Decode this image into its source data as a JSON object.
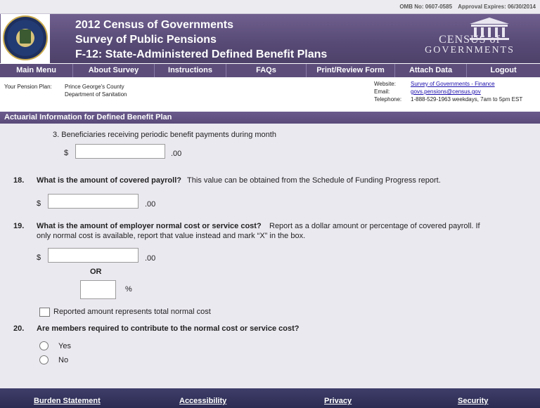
{
  "omb": {
    "number": "OMB No:  0607-0585",
    "approval": "Approval Expires:  06/30/2014"
  },
  "header": {
    "title_line1": "2012 Census of Governments",
    "title_line2": "Survey of Public Pensions",
    "title_line3": "F-12:  State-Administered Defined Benefit Plans",
    "logo_line1": "CENSUS of",
    "logo_line2": "GOVERNMENTS"
  },
  "nav": {
    "items": [
      {
        "label": "Main Menu"
      },
      {
        "label": "About Survey"
      },
      {
        "label": "Instructions"
      },
      {
        "label": "FAQs"
      },
      {
        "label": "Print/Review Form"
      },
      {
        "label": "Attach Data"
      },
      {
        "label": "Logout"
      }
    ]
  },
  "info": {
    "plan_label": "Your Pension Plan:",
    "plan_line1": "Prince George's County",
    "plan_line2": "Department of Sanitation",
    "website_label": "Website:",
    "website_value": "Survey of Governments - Finance",
    "email_label": "Email:",
    "email_value": "govs.pensions@census.gov",
    "phone_label": "Telephone:",
    "phone_value": "1-888-529-1963  weekdays, 7am to 5pm EST"
  },
  "section": {
    "title": "Actuarial Information for Defined Benefit Plan"
  },
  "q17_3": {
    "text": "3.  Beneficiaries receiving periodic benefit payments during month",
    "currency": "$",
    "cents": ".00",
    "value": ""
  },
  "q18": {
    "number": "18.",
    "question": "What is the amount of covered payroll?",
    "note": "This value can be obtained from the Schedule of Funding Progress report.",
    "currency": "$",
    "cents": ".00",
    "value": ""
  },
  "q19": {
    "number": "19.",
    "question": "What is the amount of employer normal cost or service cost?",
    "note_line1": "Report as a dollar amount or percentage of covered payroll.  If",
    "note_line2": "only normal cost is available, report that value instead and mark “X” in the box.",
    "currency": "$",
    "cents": ".00",
    "or_label": "OR",
    "percent_sign": "%",
    "checkbox_label": "Reported amount represents total normal cost",
    "amount_value": "",
    "percent_value": "",
    "checkbox_checked": false
  },
  "q20": {
    "number": "20.",
    "question": "Are members required to contribute to the normal cost or service cost?",
    "options": [
      {
        "label": "Yes",
        "selected": false
      },
      {
        "label": "No",
        "selected": false
      }
    ]
  },
  "footer": {
    "links": [
      {
        "label": "Burden Statement"
      },
      {
        "label": "Accessibility"
      },
      {
        "label": "Privacy"
      },
      {
        "label": "Security"
      }
    ]
  }
}
